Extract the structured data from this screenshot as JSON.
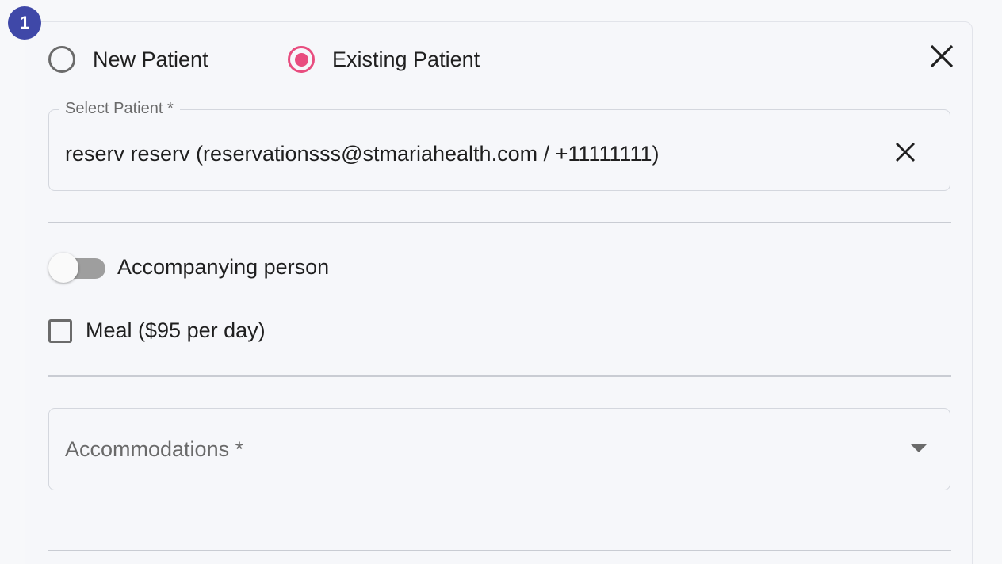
{
  "step": {
    "number": "1"
  },
  "patient_type": {
    "options": [
      {
        "label": "New Patient",
        "selected": false
      },
      {
        "label": "Existing Patient",
        "selected": true
      }
    ]
  },
  "close_icon": "close-icon",
  "select_patient": {
    "label": "Select Patient *",
    "value": "reserv reserv (reservationsss@stmariahealth.com / +11111111)",
    "clear_icon": "clear-icon"
  },
  "accompanying_person": {
    "label": "Accompanying person",
    "enabled": false
  },
  "meal": {
    "label": "Meal ($95 per day)",
    "checked": false
  },
  "accommodations": {
    "placeholder": "Accommodations *",
    "dropdown_icon": "chevron-down-icon"
  },
  "colors": {
    "step_badge": "#3f48a8",
    "radio_selected": "#e84d7f",
    "toggle_track_off": "#9e9e9e"
  }
}
